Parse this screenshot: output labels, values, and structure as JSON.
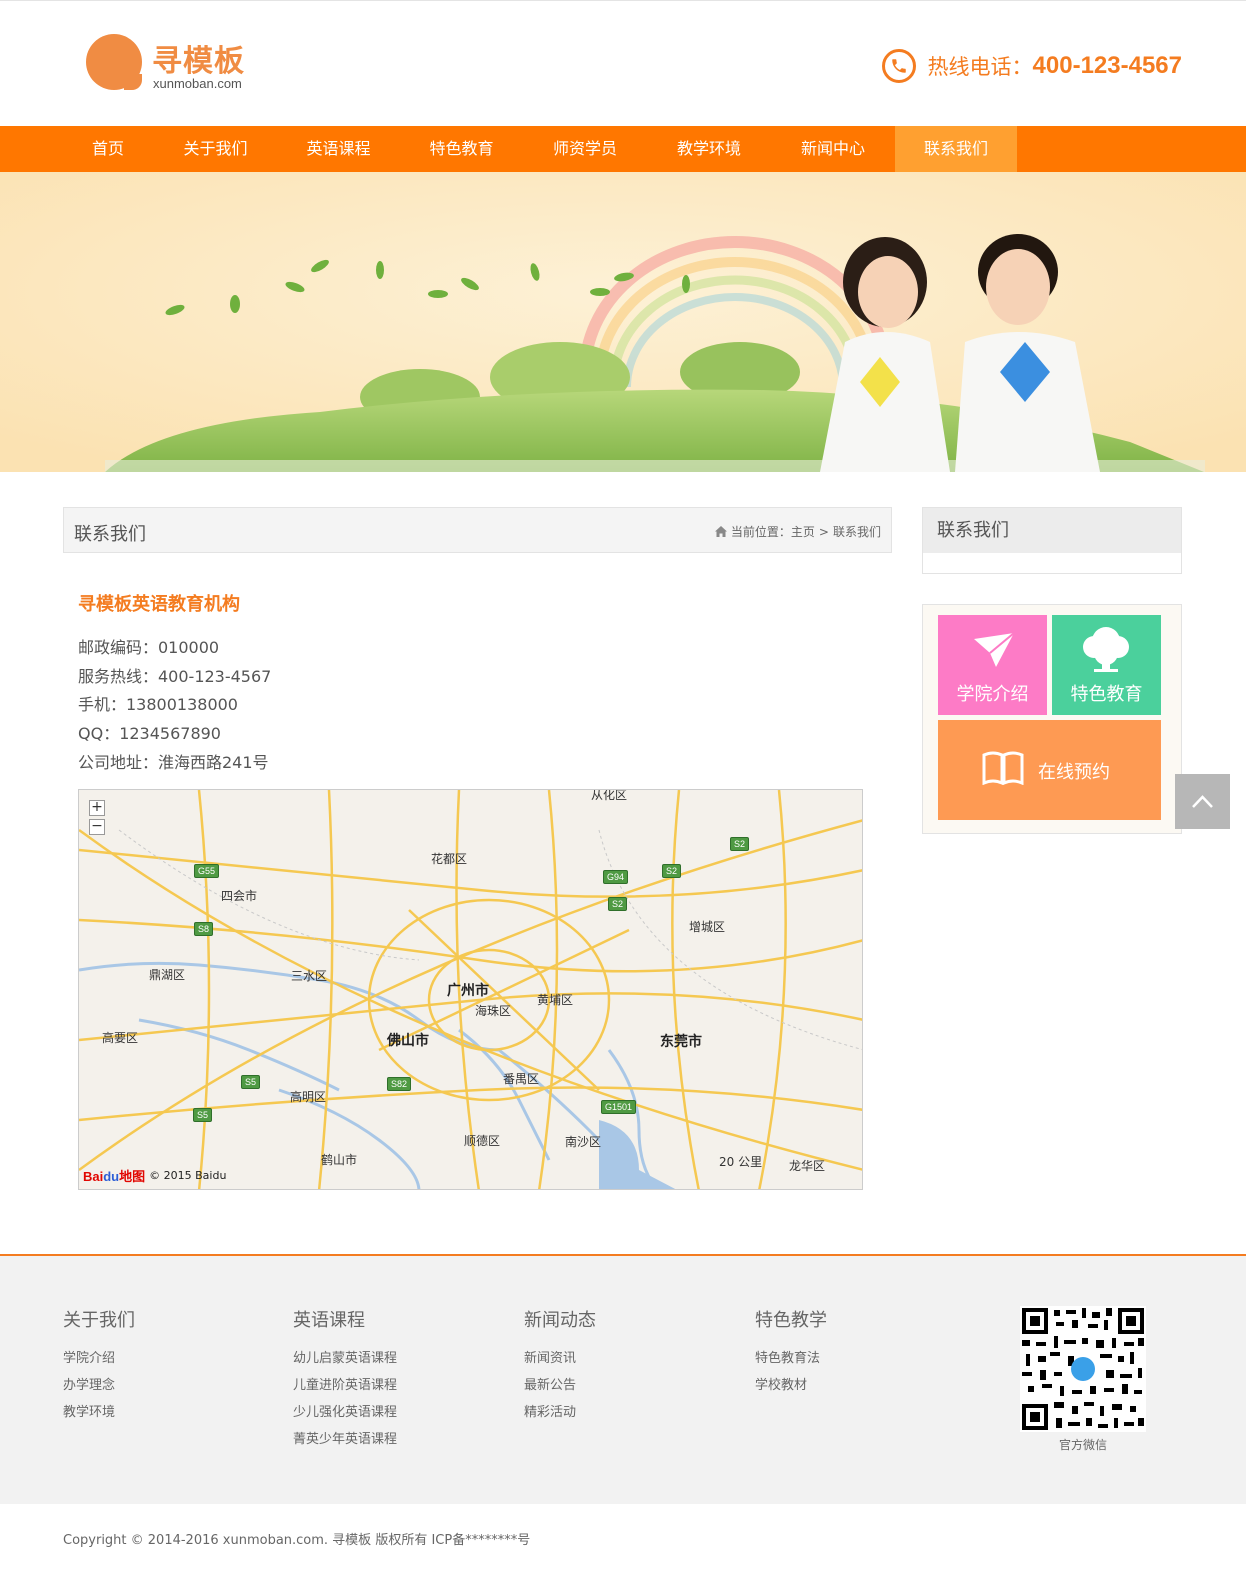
{
  "header": {
    "logo_cn": "寻模板",
    "logo_en": "xunmoban.com",
    "hotline_label": "热线电话：",
    "hotline_number": "400-123-4567"
  },
  "nav": {
    "items": [
      "首页",
      "关于我们",
      "英语课程",
      "特色教育",
      "师资学员",
      "教学环境",
      "新闻中心",
      "联系我们"
    ],
    "active": "联系我们"
  },
  "page": {
    "title": "联系我们",
    "breadcrumb_prefix": "当前位置：",
    "breadcrumb_home": "主页",
    "breadcrumb_sep": ">",
    "breadcrumb_current": "联系我们"
  },
  "contact": {
    "org_name": "寻模板英语教育机构",
    "lines": [
      "邮政编码：010000",
      "服务热线：400-123-4567",
      "手机：13800138000",
      "QQ：1234567890",
      "公司地址：淮海西路241号"
    ]
  },
  "map": {
    "zoom_in": "+",
    "zoom_out": "−",
    "labels": [
      "从化区",
      "花都区",
      "四会市",
      "增城区",
      "鼎湖区",
      "三水区",
      "广州市",
      "黄埔区",
      "海珠区",
      "高要区",
      "佛山市",
      "东莞市",
      "番禺区",
      "高明区",
      "顺德区",
      "南沙区",
      "鹤山市",
      "20 公里",
      "龙华区"
    ],
    "shields": [
      "G55",
      "S8",
      "G94",
      "S2",
      "S2",
      "S2",
      "S5",
      "S82",
      "S5",
      "G1501"
    ],
    "brand_text": "Bai",
    "brand_du": "du",
    "brand_map": "地图",
    "copyright": "© 2015 Baidu"
  },
  "sidebar": {
    "title": "联系我们",
    "tiles": [
      "学院介绍",
      "特色教育",
      "在线预约"
    ]
  },
  "footer": {
    "cols": [
      {
        "title": "关于我们",
        "links": [
          "学院介绍",
          "办学理念",
          "教学环境"
        ]
      },
      {
        "title": "英语课程",
        "links": [
          "幼儿启蒙英语课程",
          "儿童进阶英语课程",
          "少儿强化英语课程",
          "菁英少年英语课程"
        ]
      },
      {
        "title": "新闻动态",
        "links": [
          "新闻资讯",
          "最新公告",
          "精彩活动"
        ]
      },
      {
        "title": "特色教学",
        "links": [
          "特色教育法",
          "学校教材"
        ]
      }
    ],
    "qr_caption": "官方微信",
    "copyright": "Copyright © 2014-2016 xunmoban.com. 寻模板 版权所有    ICP备********号"
  },
  "colors": {
    "brand_orange": "#ff7700",
    "nav_active": "#ffa030",
    "tile_pink": "#fd7bc6",
    "tile_green": "#4bd09c",
    "tile_orange": "#fe9a53"
  }
}
